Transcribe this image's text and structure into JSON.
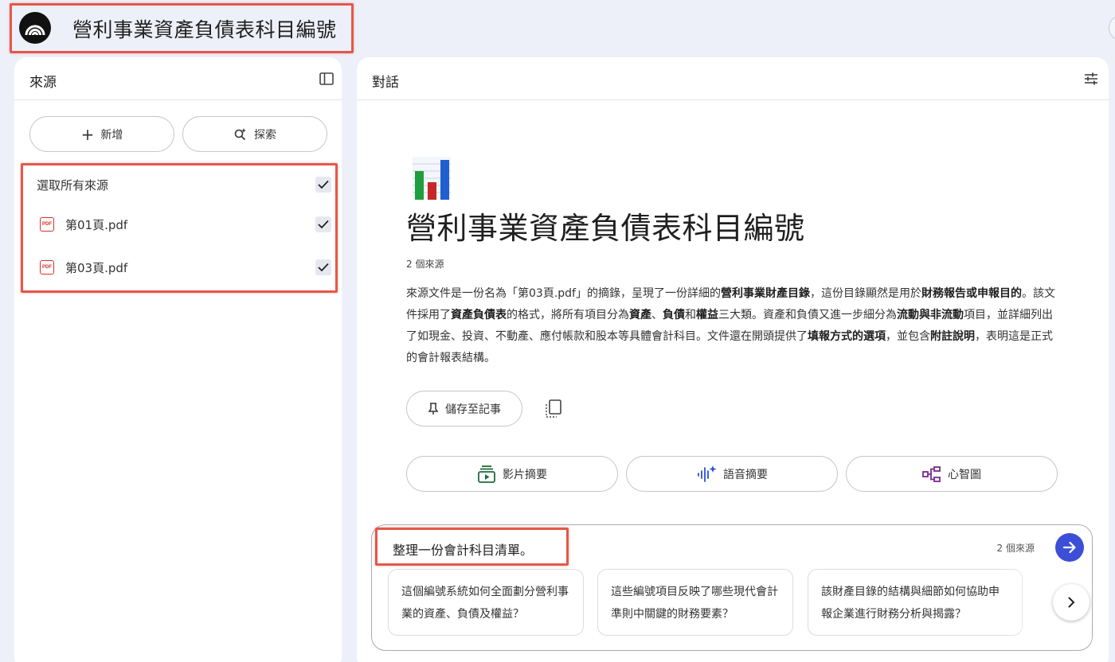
{
  "header": {
    "title": "營利事業資產負債表科目編號",
    "logo": "notebook-logo-icon"
  },
  "sources_panel": {
    "title": "來源",
    "add_label": "新增",
    "explore_label": "探索",
    "select_all_label": "選取所有來源",
    "items": [
      {
        "label": "第01頁.pdf",
        "icon": "pdf-icon",
        "checked": true
      },
      {
        "label": "第03頁.pdf",
        "icon": "pdf-icon",
        "checked": true
      }
    ],
    "pdf_glyph": "PDF"
  },
  "chat_panel": {
    "title": "對話",
    "doc_title": "營利事業資產負債表科目編號",
    "source_count": "2 個來源",
    "summary_parts": [
      {
        "t": "來源文件是一份名為「第03頁.pdf」的摘錄，呈現了一份詳細的",
        "b": false
      },
      {
        "t": "營利事業財產目錄",
        "b": true
      },
      {
        "t": "，這份目錄顯然是用於",
        "b": false
      },
      {
        "t": "財務報告或申報目的",
        "b": true
      },
      {
        "t": "。該文件採用了",
        "b": false
      },
      {
        "t": "資產負債表",
        "b": true
      },
      {
        "t": "的格式，將所有項目分為",
        "b": false
      },
      {
        "t": "資產",
        "b": true
      },
      {
        "t": "、",
        "b": false
      },
      {
        "t": "負債",
        "b": true
      },
      {
        "t": "和",
        "b": false
      },
      {
        "t": "權益",
        "b": true
      },
      {
        "t": "三大類。資產和負債又進一步細分為",
        "b": false
      },
      {
        "t": "流動與非流動",
        "b": true
      },
      {
        "t": "項目，並詳細列出了如現金、投資、不動產、應付帳款和股本等具體會計科目。文件還在開頭提供了",
        "b": false
      },
      {
        "t": "填報方式的選項",
        "b": true
      },
      {
        "t": "，並包含",
        "b": false
      },
      {
        "t": "附註說明",
        "b": true
      },
      {
        "t": "，表明這是正式的會計報表結構。",
        "b": false
      }
    ],
    "save_note_label": "儲存至記事",
    "actions": [
      {
        "label": "影片摘要",
        "icon": "video-overview-icon",
        "color": "#1e6b3a"
      },
      {
        "label": "語音摘要",
        "icon": "audio-overview-icon",
        "color": "#2d4fd8"
      },
      {
        "label": "心智圖",
        "icon": "mind-map-icon",
        "color": "#7b2a8f"
      }
    ],
    "input": {
      "value": "整理一份會計科目清單。",
      "source_count": "2 個來源",
      "suggestions": [
        "這個編號系統如何全面劃分營利事業的資產、負債及權益？",
        "這些編號項目反映了哪些現代會計準則中關鍵的財務要素？",
        "該財產目錄的結構與細節如何協助申報企業進行財務分析與揭露？"
      ]
    }
  },
  "colors": {
    "highlight_box": "#e5574a",
    "send_button": "#3c4fd6",
    "background": "#eef0f9"
  }
}
